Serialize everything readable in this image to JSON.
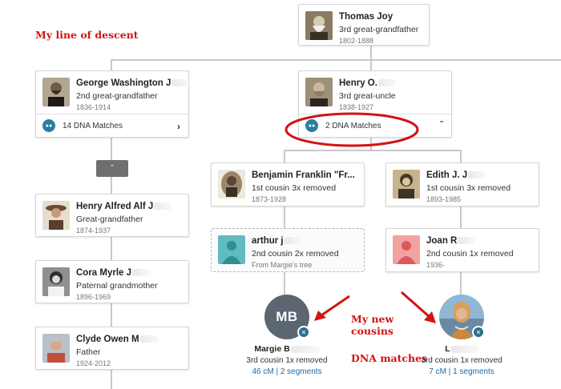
{
  "annotations": {
    "line_of_descent": "My line of descent",
    "new_cousins_line1": "My new",
    "new_cousins_line2": "cousins",
    "dna_matches": "DNA matches"
  },
  "colors": {
    "annotation_red": "#d11414",
    "dna_badge_blue": "#2a7fa0",
    "link_blue": "#1c6aa6",
    "connector_gray": "#c9c9c9",
    "collapse_button": "#6f6f6f"
  },
  "cards": {
    "thomas": {
      "name": "Thomas Joy",
      "relationship": "3rd great-grandfather",
      "years": "1802-1888",
      "photo": "portrait-photo"
    },
    "george": {
      "name": "George Washington J",
      "relationship": "2nd great-grandfather",
      "years": "1836-1914",
      "photo": "portrait-photo",
      "dna_matches": "14 DNA Matches",
      "toggle_icon": "chevron-right-icon"
    },
    "henry_o": {
      "name": "Henry O.",
      "relationship": "3rd great-uncle",
      "years": "1838-1927",
      "photo": "portrait-photo",
      "dna_matches": "2 DNA Matches",
      "toggle_icon": "chevron-up-icon"
    },
    "henry_alfred": {
      "name": "Henry Alfred Alf J",
      "relationship": "Great-grandfather",
      "years": "1874-1937",
      "photo": "portrait-photo"
    },
    "cora": {
      "name": "Cora Myrle J",
      "relationship": "Paternal grandmother",
      "years": "1896-1969",
      "photo": "portrait-photo"
    },
    "clyde": {
      "name": "Clyde Owen M",
      "relationship": "Father",
      "years": "1924-2012",
      "photo": "portrait-photo"
    },
    "benjamin": {
      "name": "Benjamin Franklin \"Fr...",
      "relationship": "1st cousin 3x removed",
      "years": "1873-1928",
      "photo": "portrait-photo"
    },
    "edith": {
      "name": "Edith J. J",
      "relationship": "1st cousin 3x removed",
      "years": "1893-1985",
      "photo": "portrait-photo"
    },
    "arthur": {
      "name": "arthur j",
      "relationship": "2nd cousin 2x removed",
      "years": "From Margie's tree",
      "photo": "silhouette-male-icon"
    },
    "joan": {
      "name": "Joan R",
      "relationship": "2nd cousin 1x removed",
      "years": "1936-",
      "photo": "silhouette-female-icon"
    }
  },
  "matches": [
    {
      "initials": "MB",
      "name": "Margie B",
      "relationship": "3rd cousin 1x removed",
      "cm": "46 cM",
      "segments": "2 segments",
      "separator": " | ",
      "badge_icon": "dna-x-icon"
    },
    {
      "initials": "",
      "name": "L",
      "relationship": "3rd cousin 1x removed",
      "cm": "7 cM",
      "segments": "1 segments",
      "separator": " | ",
      "badge_icon": "dna-x-icon"
    }
  ],
  "collapse_button": {
    "icon": "chevron-up-icon"
  },
  "highlight": {
    "shape": "ellipse",
    "color": "#d11414"
  }
}
